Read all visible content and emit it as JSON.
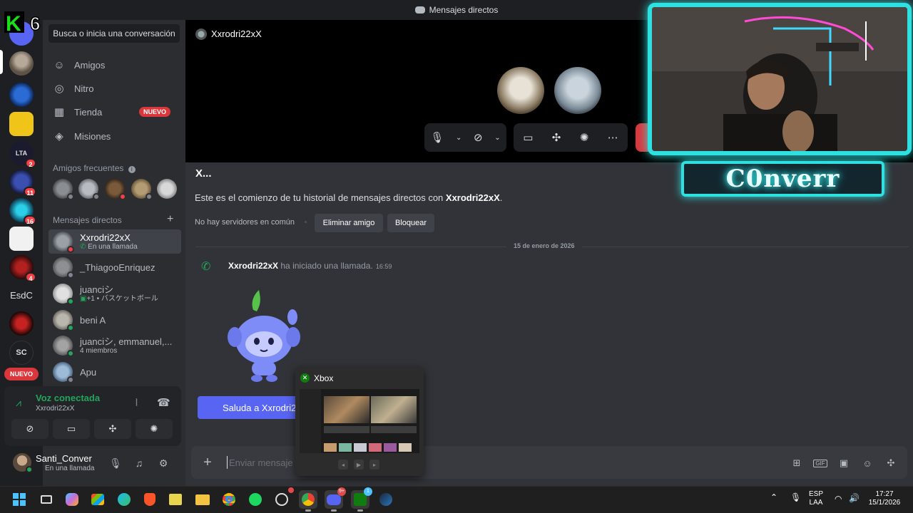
{
  "window": {
    "title": "Mensajes directos"
  },
  "logo": {
    "text": "K",
    "number": "6"
  },
  "rail": {
    "servers": [
      {
        "name": "server-home",
        "badge": ""
      },
      {
        "name": "server-avatar",
        "badge": ""
      },
      {
        "name": "server-ascension",
        "badge": ""
      },
      {
        "name": "server-yellow",
        "badge": ""
      },
      {
        "name": "server-lta",
        "label": "LTA",
        "badge": "2"
      },
      {
        "name": "server-blue",
        "badge": "11"
      },
      {
        "name": "server-cyan",
        "badge": "16"
      },
      {
        "name": "server-madstore",
        "badge": ""
      },
      {
        "name": "server-bajo-mafia",
        "badge": "4"
      },
      {
        "name": "server-esdc",
        "label": "EsdC",
        "badge": ""
      },
      {
        "name": "server-bajo-facciones",
        "badge": ""
      },
      {
        "name": "server-sc",
        "label": "SC",
        "badge": ""
      }
    ],
    "nuevo_label": "NUEVO"
  },
  "sidebar": {
    "search_label": "Busca o inicia una conversación",
    "nav": [
      {
        "label": "Amigos",
        "icon": "friends-icon"
      },
      {
        "label": "Nitro",
        "icon": "nitro-icon"
      },
      {
        "label": "Tienda",
        "icon": "shop-icon"
      },
      {
        "label": "Misiones",
        "icon": "quests-icon"
      }
    ],
    "shop_badge": "NUEVO",
    "frequent_title": "Amigos frecuentes",
    "dm_title": "Mensajes directos",
    "dms": [
      {
        "name": "Xxrodri22xX",
        "sub": "En una llamada",
        "status": "busy"
      },
      {
        "name": "_ThiagooEnriquez",
        "sub": "",
        "status": "offline"
      },
      {
        "name": "juanciシ",
        "sub": "+1 • バスケットボール",
        "status": "online"
      },
      {
        "name": "beni A",
        "sub": "",
        "status": "online"
      },
      {
        "name": "juanciシ, emmanuel,...",
        "sub": "4 miembros",
        "status": "group"
      },
      {
        "name": "Apu",
        "sub": "",
        "status": "offline"
      }
    ]
  },
  "voice": {
    "title": "Voz conectada",
    "channel": "Xxrodri22xX"
  },
  "user": {
    "name": "Santi_Conver",
    "status": "En una llamada"
  },
  "call": {
    "header_name": "Xxrodri22xX"
  },
  "chat": {
    "title": "X...",
    "intro_prefix": "Este es el comienzo de tu historial de mensajes directos con ",
    "intro_name": "Xxrodri22xX",
    "intro_suffix": ".",
    "common_servers": "No hay servidores en común",
    "remove_friend": "Eliminar amigo",
    "block": "Bloquear",
    "date": "15 de enero de 2026",
    "call_user": "Xxrodri22xX",
    "call_text": " ha iniciado una llamada.",
    "call_time": "16:59",
    "wave_button": "Saluda a Xxrodri2",
    "input_placeholder": "Enviar mensaje a"
  },
  "xbox_preview": {
    "title": "Xbox"
  },
  "overlay": {
    "nameplate": "C0nverr"
  },
  "taskbar": {
    "lang_top": "ESP",
    "lang_bottom": "LAA",
    "time": "17:27",
    "date": "15/1/2026",
    "discord_badge": "9+",
    "xbox_badge": "1"
  },
  "colors": {
    "accent": "#5865f2",
    "online": "#23a55a",
    "danger": "#da373c",
    "neon": "#2fe0e0"
  }
}
